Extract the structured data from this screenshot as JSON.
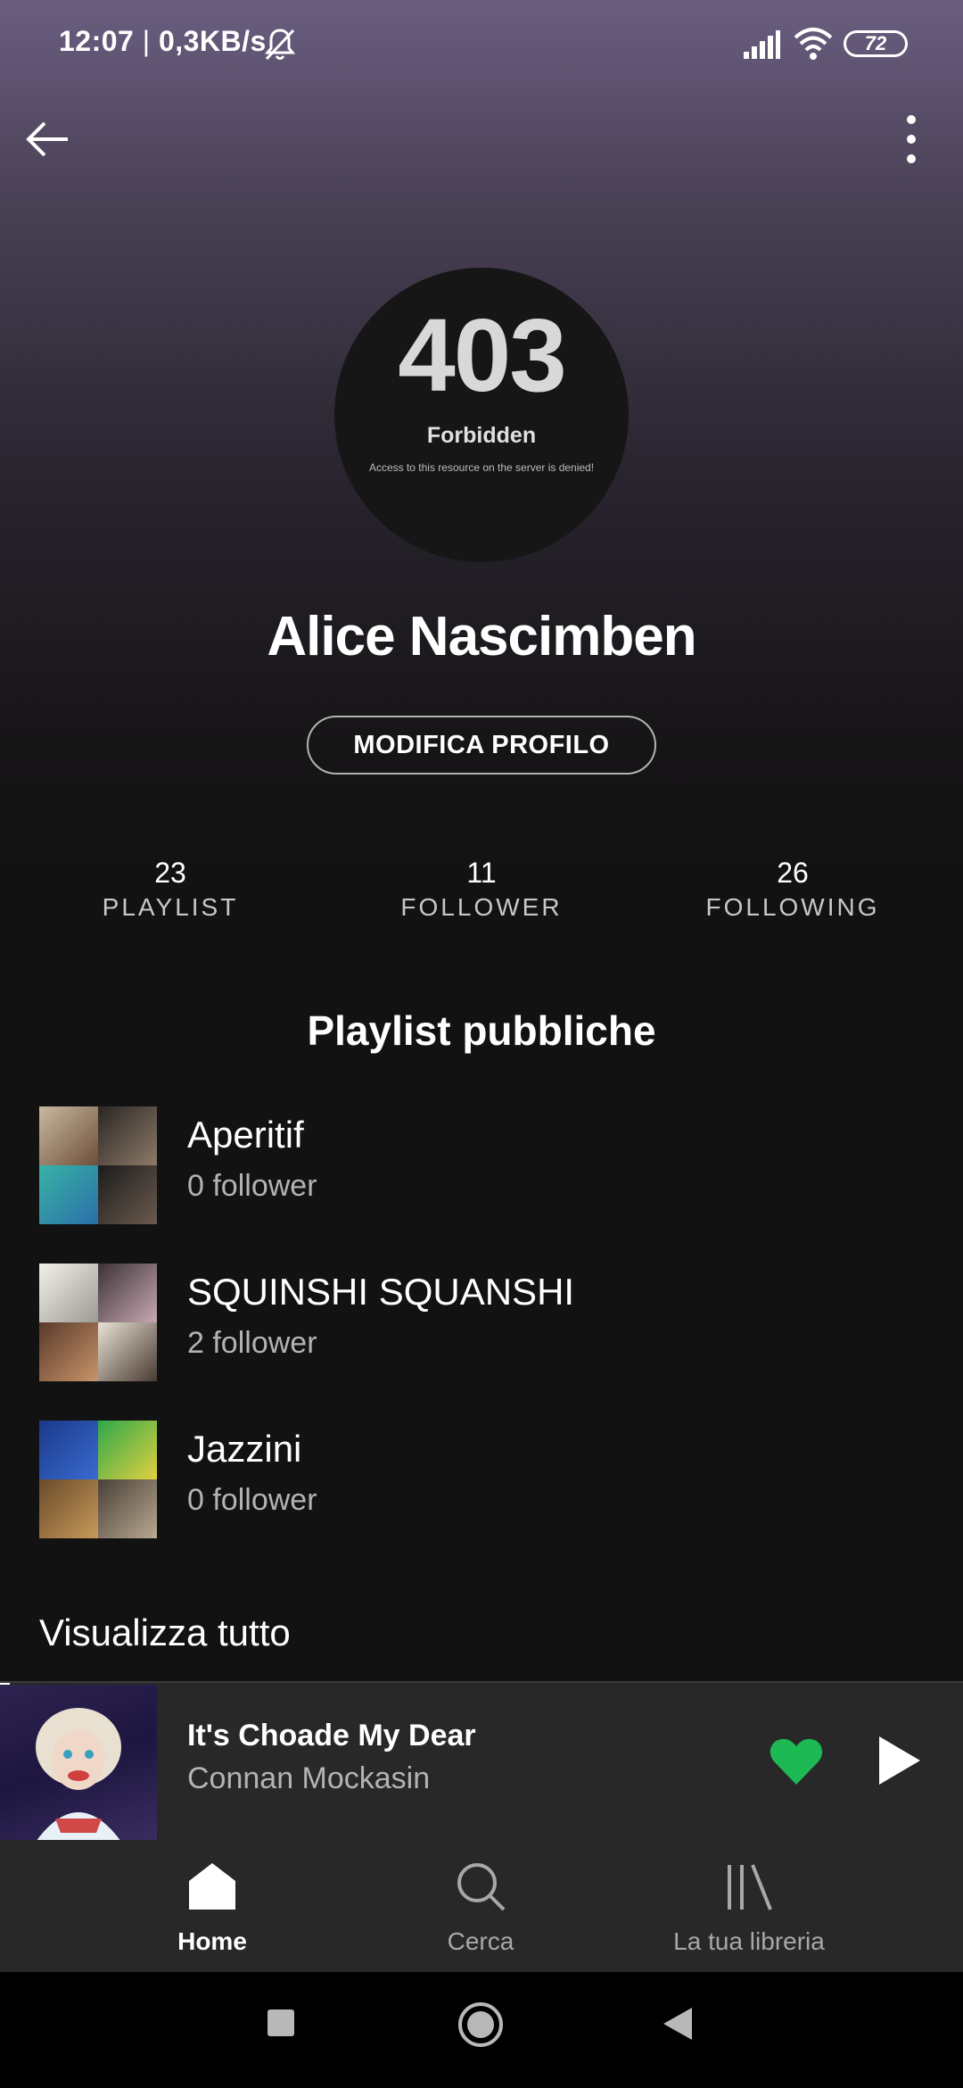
{
  "status_bar": {
    "time": "12:07",
    "separator": " | ",
    "net_speed": "0,3KB/s",
    "battery": "72"
  },
  "profile": {
    "avatar_error_code": "403",
    "avatar_error_title": "Forbidden",
    "avatar_error_message": "Access to this resource on the server is denied!",
    "name": "Alice Nascimben",
    "edit_button": "MODIFICA PROFILO"
  },
  "stats": [
    {
      "value": "23",
      "label": "PLAYLIST"
    },
    {
      "value": "11",
      "label": "FOLLOWER"
    },
    {
      "value": "26",
      "label": "FOLLOWING"
    }
  ],
  "playlists_section": {
    "title": "Playlist pubbliche",
    "items": [
      {
        "name": "Aperitif",
        "followers": "0 follower"
      },
      {
        "name": "SQUINSHI SQUANSHI",
        "followers": "2 follower"
      },
      {
        "name": "Jazzini",
        "followers": "0 follower"
      }
    ],
    "view_all": "Visualizza tutto"
  },
  "now_playing": {
    "title": "It's Choade My Dear",
    "artist": "Connan Mockasin",
    "liked": true,
    "progress": 0.01,
    "accent_color": "#1db954"
  },
  "bottom_nav": [
    {
      "label": "Home",
      "icon": "home-icon",
      "active": true
    },
    {
      "label": "Cerca",
      "icon": "search-icon",
      "active": false
    },
    {
      "label": "La tua libreria",
      "icon": "library-icon",
      "active": false
    }
  ],
  "system_nav": [
    "recents-icon",
    "home-circle-icon",
    "back-triangle-icon"
  ]
}
